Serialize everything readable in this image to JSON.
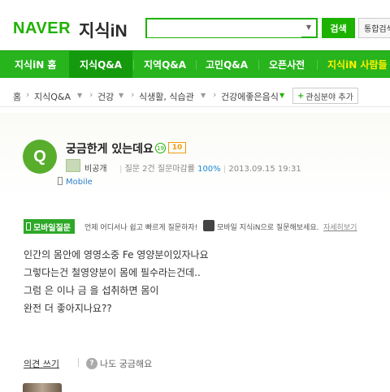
{
  "header": {
    "logo": "NAVER",
    "service": "지식iN",
    "search_placeholder": "",
    "search_button": "검색",
    "total_search_button": "통합검색"
  },
  "nav": {
    "items": [
      {
        "label": "지식iN 홈"
      },
      {
        "label": "지식Q&A"
      },
      {
        "label": "지역Q&A"
      },
      {
        "label": "고민Q&A"
      },
      {
        "label": "오픈사전"
      },
      {
        "label": "지식iN 사람들"
      }
    ],
    "active_index": 1
  },
  "breadcrumb": {
    "home": "홈",
    "items": [
      "지식Q&A",
      "건강",
      "식생활, 식습관",
      "건강에좋은음식"
    ],
    "add_interest": "관심분야 추가"
  },
  "question": {
    "badge": "Q",
    "title": "궁금한게 있는데요",
    "age_badge": "19",
    "points": "10",
    "author": "비공개",
    "meta_prefix": "질문 2건 질문마감률",
    "close_rate": "100%",
    "date": "2013.09.15 19:31",
    "source": "Mobile"
  },
  "mobile_banner": {
    "label": "모바일질문",
    "text": "언제 어디서나 쉽고 빠르게 질문하자!",
    "text2": "모바일 지식iN으로 질문해보세요.",
    "link": "자세히보기"
  },
  "body": {
    "lines": [
      "인간의 몸안에 영영소중 Fe 영양분이있자나요",
      "그렇다는건 철영양분이 몸에 필수라는건데..",
      "그럼 은 이나 금 을 섭취하면 몸이",
      "완전 더 좋아지나요??"
    ]
  },
  "actions": {
    "opinion": "의견 쓰기",
    "curious": "나도 궁금해요"
  },
  "colors": {
    "brand_green": "#1eb200",
    "nav_green": "#27b41d",
    "point_orange": "#f39a10"
  }
}
